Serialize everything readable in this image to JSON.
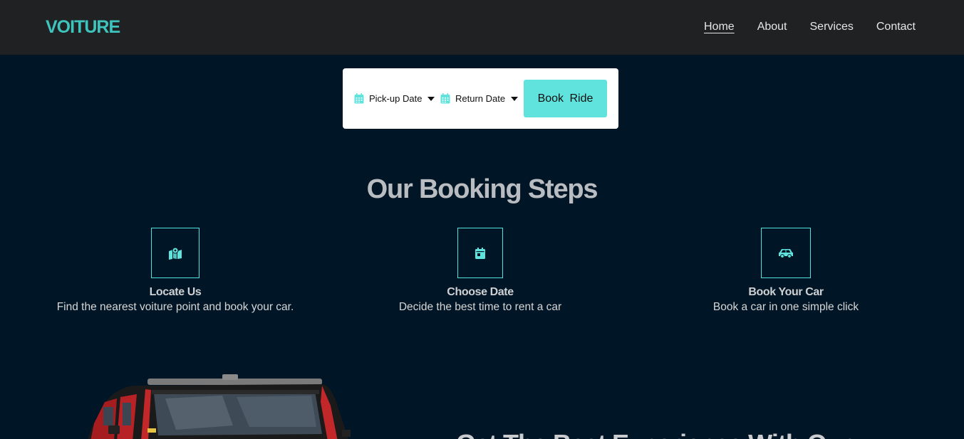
{
  "header": {
    "logo": "VOITURE",
    "nav": [
      {
        "label": "Home",
        "active": true
      },
      {
        "label": "About"
      },
      {
        "label": "Services"
      },
      {
        "label": "Contact"
      }
    ]
  },
  "booking": {
    "pickup_label": "Pick-up Date",
    "return_label": "Return Date",
    "book_button": "Book  Ride"
  },
  "steps_section": {
    "title": "Our Booking Steps",
    "steps": [
      {
        "icon": "map-icon",
        "title": "Locate Us",
        "desc": "Find the nearest voiture point and book your car."
      },
      {
        "icon": "calendar-icon",
        "title": "Choose Date",
        "desc": "Decide the best time to rent a car"
      },
      {
        "icon": "car-icon",
        "title": "Book Your Car",
        "desc": "Book a car in one simple click"
      }
    ]
  },
  "promo": {
    "headline_partial": "Get The Best Experience With Our"
  },
  "colors": {
    "accent": "#5fe3dc",
    "logo": "#3fc4bd",
    "background": "#001526",
    "navbar": "#1f2123"
  }
}
